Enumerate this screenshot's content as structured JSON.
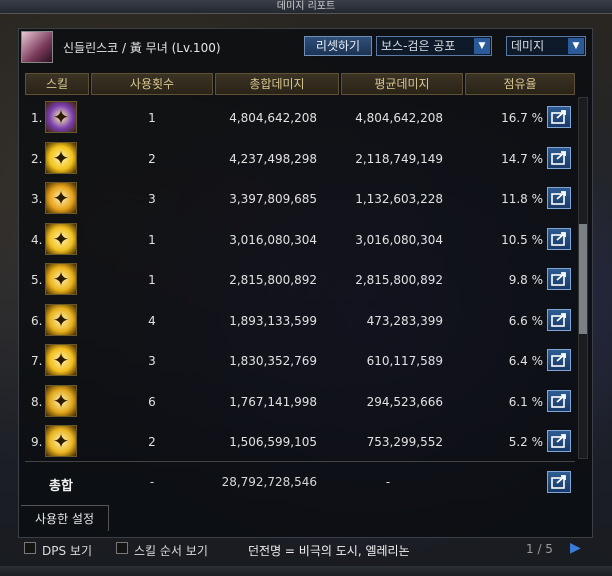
{
  "window": {
    "title": "데미지 리포트"
  },
  "header": {
    "character": "신들린스코 / 黃 무녀 (Lv.100)",
    "reset_label": "리셋하기",
    "boss_select": "보스-검은 공포",
    "type_select": "데미지"
  },
  "columns": {
    "skill": "스킬",
    "uses": "사용횟수",
    "total": "총합데미지",
    "avg": "평균데미지",
    "share": "점유율"
  },
  "rows": [
    {
      "rank": "1.",
      "uses": "1",
      "total": "4,804,642,208",
      "avg": "4,804,642,208",
      "share": "16.7 %",
      "icon": "violet-spirit-icon",
      "color": "#7a3fb0"
    },
    {
      "rank": "2.",
      "uses": "2",
      "total": "4,237,498,298",
      "avg": "2,118,749,149",
      "share": "14.7 %",
      "icon": "sun-burst-icon",
      "color": "#f2c21a"
    },
    {
      "rank": "3.",
      "uses": "3",
      "total": "3,397,809,685",
      "avg": "1,132,603,228",
      "share": "11.8 %",
      "icon": "fire-blade-icon",
      "color": "#e6a21a"
    },
    {
      "rank": "4.",
      "uses": "1",
      "total": "3,016,080,304",
      "avg": "3,016,080,304",
      "share": "10.5 %",
      "icon": "golden-wheel-icon",
      "color": "#f0c020"
    },
    {
      "rank": "5.",
      "uses": "1",
      "total": "2,815,800,892",
      "avg": "2,815,800,892",
      "share": "9.8 %",
      "icon": "golden-dragon-icon",
      "color": "#eab21a"
    },
    {
      "rank": "6.",
      "uses": "4",
      "total": "1,893,133,599",
      "avg": "473,283,399",
      "share": "6.6 %",
      "icon": "golden-shield-icon",
      "color": "#e8b01c"
    },
    {
      "rank": "7.",
      "uses": "3",
      "total": "1,830,352,769",
      "avg": "610,117,589",
      "share": "6.4 %",
      "icon": "golden-claw-icon",
      "color": "#f2bc1c"
    },
    {
      "rank": "8.",
      "uses": "6",
      "total": "1,767,141,998",
      "avg": "294,523,666",
      "share": "6.1 %",
      "icon": "golden-spiral-icon",
      "color": "#e0a61a"
    },
    {
      "rank": "9.",
      "uses": "2",
      "total": "1,506,599,105",
      "avg": "753,299,552",
      "share": "5.2 %",
      "icon": "golden-orb-icon",
      "color": "#eab420"
    }
  ],
  "total": {
    "label": "총합",
    "uses": "-",
    "total": "28,792,728,546",
    "avg": "-"
  },
  "used_settings": "사용한 설정",
  "bottom": {
    "dps_label": "DPS 보기",
    "order_label": "스킬 순서 보기",
    "dungeon": "던전명 = 비극의 도시, 엘레리논",
    "pager": "1 / 5"
  }
}
